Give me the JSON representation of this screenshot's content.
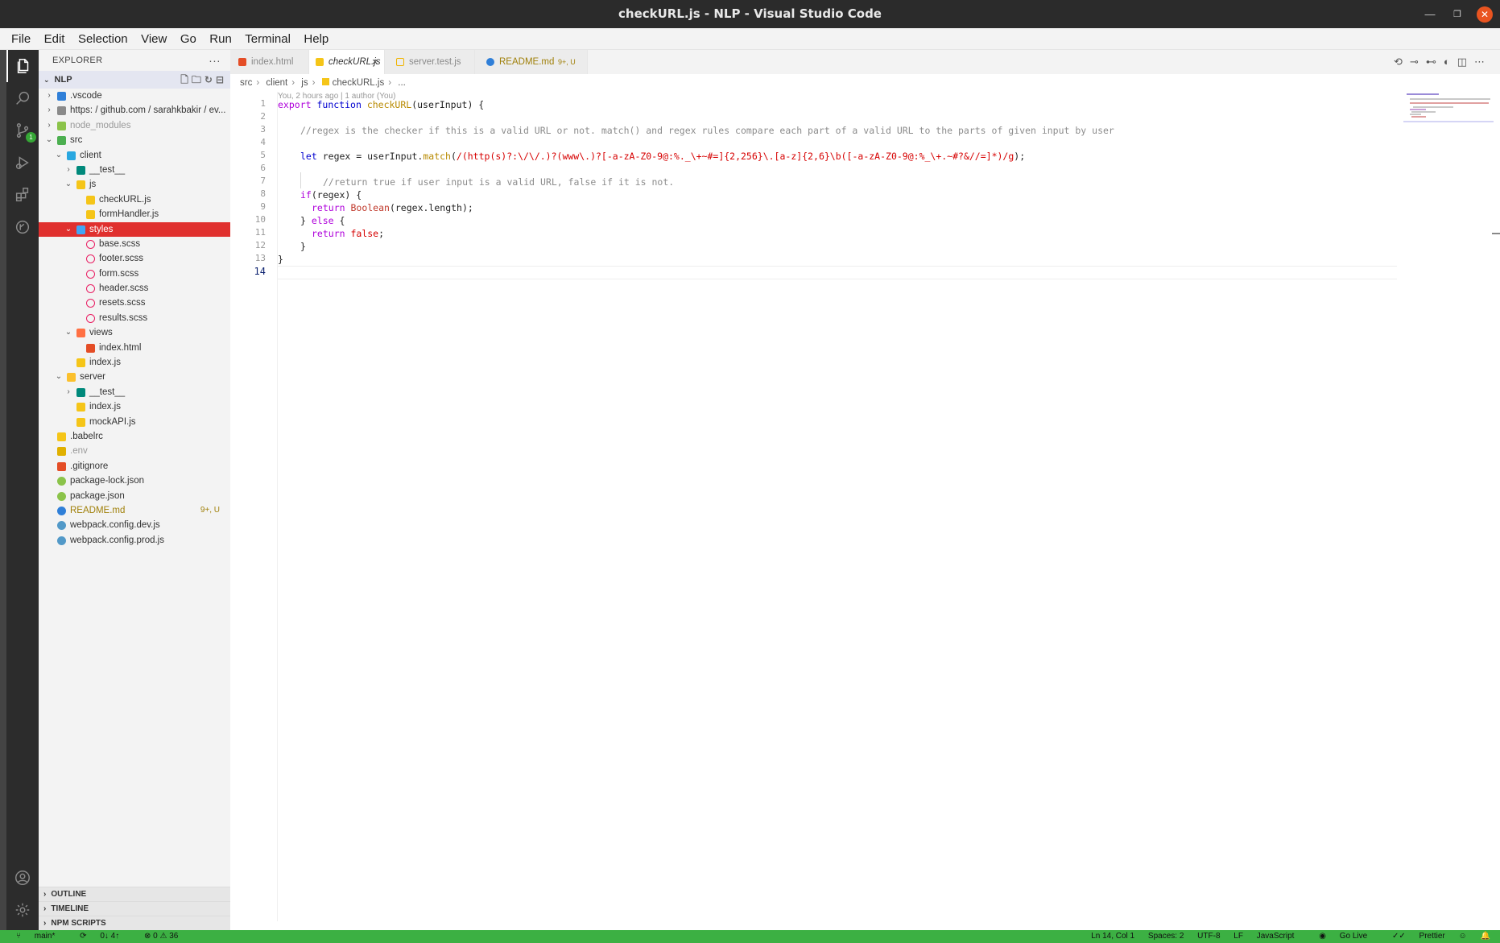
{
  "window": {
    "title": "checkURL.js - NLP - Visual Studio Code"
  },
  "menu": [
    "File",
    "Edit",
    "Selection",
    "View",
    "Go",
    "Run",
    "Terminal",
    "Help"
  ],
  "activity_bar": {
    "items": [
      "explorer-icon",
      "search-icon",
      "source-control-icon",
      "run-debug-icon",
      "extensions-icon",
      "git-graph-icon"
    ],
    "bottom": [
      "account-icon",
      "settings-gear-icon"
    ],
    "scm_badge": "1"
  },
  "sidebar": {
    "header": "EXPLORER",
    "more": "···",
    "project": "NLP",
    "tree": [
      {
        "name": ".vscode",
        "type": "folder",
        "depth": 0,
        "expanded": false,
        "icon": "folder-vscode"
      },
      {
        "name": "https: / github.com / sarahkbakir / ev...",
        "type": "folder",
        "depth": 0,
        "expanded": false,
        "icon": "folder"
      },
      {
        "name": "node_modules",
        "type": "folder",
        "depth": 0,
        "expanded": false,
        "icon": "folder-node",
        "dim": true
      },
      {
        "name": "src",
        "type": "folder",
        "depth": 0,
        "expanded": true,
        "icon": "folder-src"
      },
      {
        "name": "client",
        "type": "folder",
        "depth": 1,
        "expanded": true,
        "icon": "folder-client"
      },
      {
        "name": "__test__",
        "type": "folder",
        "depth": 2,
        "expanded": false,
        "icon": "folder-test"
      },
      {
        "name": "js",
        "type": "folder",
        "depth": 2,
        "expanded": true,
        "icon": "folder-js"
      },
      {
        "name": "checkURL.js",
        "type": "file",
        "depth": 3,
        "icon": "js"
      },
      {
        "name": "formHandler.js",
        "type": "file",
        "depth": 3,
        "icon": "js"
      },
      {
        "name": "styles",
        "type": "folder",
        "depth": 2,
        "expanded": true,
        "icon": "folder-styles",
        "selected": true
      },
      {
        "name": "base.scss",
        "type": "file",
        "depth": 3,
        "icon": "scss"
      },
      {
        "name": "footer.scss",
        "type": "file",
        "depth": 3,
        "icon": "scss"
      },
      {
        "name": "form.scss",
        "type": "file",
        "depth": 3,
        "icon": "scss"
      },
      {
        "name": "header.scss",
        "type": "file",
        "depth": 3,
        "icon": "scss"
      },
      {
        "name": "resets.scss",
        "type": "file",
        "depth": 3,
        "icon": "scss"
      },
      {
        "name": "results.scss",
        "type": "file",
        "depth": 3,
        "icon": "scss"
      },
      {
        "name": "views",
        "type": "folder",
        "depth": 2,
        "expanded": true,
        "icon": "folder-views"
      },
      {
        "name": "index.html",
        "type": "file",
        "depth": 3,
        "icon": "html"
      },
      {
        "name": "index.js",
        "type": "file",
        "depth": 2,
        "icon": "js"
      },
      {
        "name": "server",
        "type": "folder",
        "depth": 1,
        "expanded": true,
        "icon": "folder-server"
      },
      {
        "name": "__test__",
        "type": "folder",
        "depth": 2,
        "expanded": false,
        "icon": "folder-test"
      },
      {
        "name": "index.js",
        "type": "file",
        "depth": 2,
        "icon": "js"
      },
      {
        "name": "mockAPI.js",
        "type": "file",
        "depth": 2,
        "icon": "js"
      },
      {
        "name": ".babelrc",
        "type": "file",
        "depth": 0,
        "icon": "babel"
      },
      {
        "name": ".env",
        "type": "file",
        "depth": 0,
        "icon": "env",
        "dim": true
      },
      {
        "name": ".gitignore",
        "type": "file",
        "depth": 0,
        "icon": "git"
      },
      {
        "name": "package-lock.json",
        "type": "file",
        "depth": 0,
        "icon": "npm"
      },
      {
        "name": "package.json",
        "type": "file",
        "depth": 0,
        "icon": "npm"
      },
      {
        "name": "README.md",
        "type": "file",
        "depth": 0,
        "icon": "info",
        "modified": true,
        "decoration": "9+, U"
      },
      {
        "name": "webpack.config.dev.js",
        "type": "file",
        "depth": 0,
        "icon": "webpack"
      },
      {
        "name": "webpack.config.prod.js",
        "type": "file",
        "depth": 0,
        "icon": "webpack"
      }
    ],
    "panels": [
      "OUTLINE",
      "TIMELINE",
      "NPM SCRIPTS"
    ]
  },
  "tabs": [
    {
      "label": "index.html",
      "icon": "html",
      "active": false
    },
    {
      "label": "checkURL.js",
      "icon": "js",
      "active": true,
      "close": "×"
    },
    {
      "label": "server.test.js",
      "icon": "test",
      "active": false
    },
    {
      "label": "README.md",
      "icon": "info",
      "active": false,
      "badge": "9+, U"
    }
  ],
  "breadcrumb": [
    "src",
    "client",
    "js",
    "checkURL.js",
    "..."
  ],
  "editor": {
    "blame": "You, 2 hours ago | 1 author (You)",
    "current_line": 14,
    "line_numbers": [
      "1",
      "2",
      "3",
      "4",
      "5",
      "6",
      "7",
      "8",
      "9",
      "10",
      "11",
      "12",
      "13",
      "14"
    ]
  },
  "statusbar": {
    "branch": "main*",
    "sync": "0↓ 4↑",
    "problems": "⊗ 0 ⚠ 36",
    "position": "Ln 14, Col 1",
    "spaces": "Spaces: 2",
    "encoding": "UTF-8",
    "eol": "LF",
    "language": "JavaScript",
    "golive": "Go Live",
    "prettier": "Prettier"
  },
  "colors": {
    "statusbar": "#3cb043",
    "selection": "#e0302e",
    "titlebar": "#2b2b2b",
    "activitybar": "#2c2c2c"
  }
}
